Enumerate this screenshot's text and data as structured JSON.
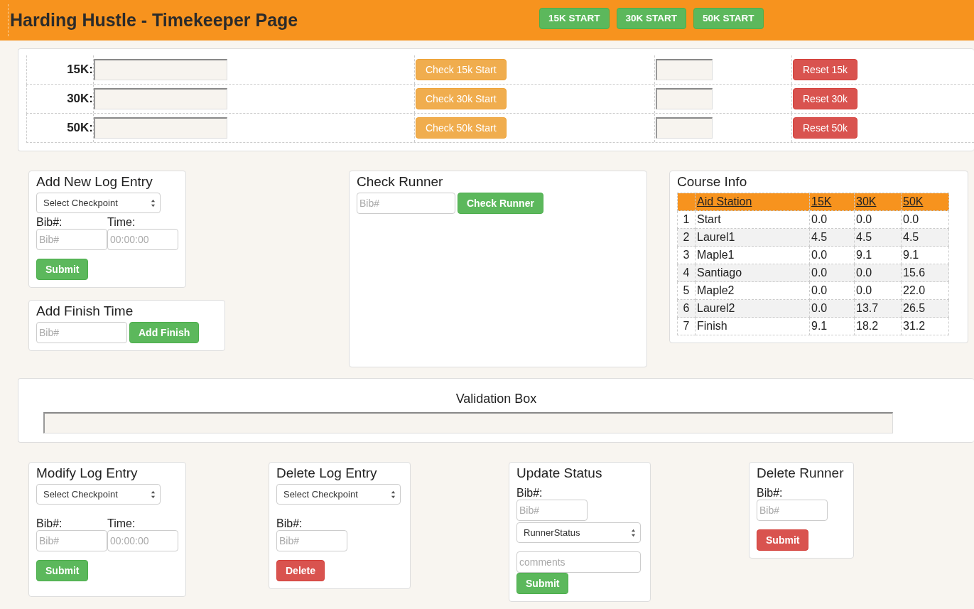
{
  "header": {
    "title": "Harding Hustle - Timekeeper Page",
    "start_buttons": [
      "15K START",
      "30K START",
      "50K START"
    ]
  },
  "start_checks": [
    {
      "label": "15K:",
      "check_button": "Check 15k Start",
      "reset_button": "Reset 15k"
    },
    {
      "label": "30K:",
      "check_button": "Check 30k Start",
      "reset_button": "Reset 30k"
    },
    {
      "label": "50K:",
      "check_button": "Check 50k Start",
      "reset_button": "Reset 50k"
    }
  ],
  "add_log_entry": {
    "title": "Add New Log Entry",
    "select": "Select Checkpoint",
    "bib_label": "Bib#:",
    "time_label": "Time:",
    "bib_placeholder": "Bib#",
    "time_placeholder": "00:00:00",
    "button": "Submit"
  },
  "add_finish": {
    "title": "Add Finish Time",
    "bib_placeholder": "Bib#",
    "button": "Add Finish"
  },
  "check_runner": {
    "title": "Check Runner",
    "bib_placeholder": "Bib#",
    "button": "Check Runner"
  },
  "course_info": {
    "title": "Course Info",
    "columns": [
      "",
      "Aid Station",
      "15K",
      "30K",
      "50K"
    ],
    "rows": [
      [
        "1",
        "Start",
        "0.0",
        "0.0",
        "0.0"
      ],
      [
        "2",
        "Laurel1",
        "4.5",
        "4.5",
        "4.5"
      ],
      [
        "3",
        "Maple1",
        "0.0",
        "9.1",
        "9.1"
      ],
      [
        "4",
        "Santiago",
        "0.0",
        "0.0",
        "15.6"
      ],
      [
        "5",
        "Maple2",
        "0.0",
        "0.0",
        "22.0"
      ],
      [
        "6",
        "Laurel2",
        "0.0",
        "13.7",
        "26.5"
      ],
      [
        "7",
        "Finish",
        "9.1",
        "18.2",
        "31.2"
      ]
    ]
  },
  "validation": {
    "title": "Validation Box"
  },
  "modify_log_entry": {
    "title": "Modify Log Entry",
    "select": "Select Checkpoint",
    "bib_label": "Bib#:",
    "time_label": "Time:",
    "bib_placeholder": "Bib#",
    "time_placeholder": "00:00:00",
    "button": "Submit"
  },
  "delete_log_entry": {
    "title": "Delete Log Entry",
    "select": "Select Checkpoint",
    "bib_label": "Bib#:",
    "bib_placeholder": "Bib#",
    "button": "Delete"
  },
  "update_status": {
    "title": "Update Status",
    "bib_label": "Bib#:",
    "bib_placeholder": "Bib#",
    "select": "RunnerStatus",
    "comments_placeholder": "comments",
    "button": "Submit"
  },
  "delete_runner": {
    "title": "Delete Runner",
    "bib_label": "Bib#:",
    "bib_placeholder": "Bib#",
    "button": "Submit"
  }
}
